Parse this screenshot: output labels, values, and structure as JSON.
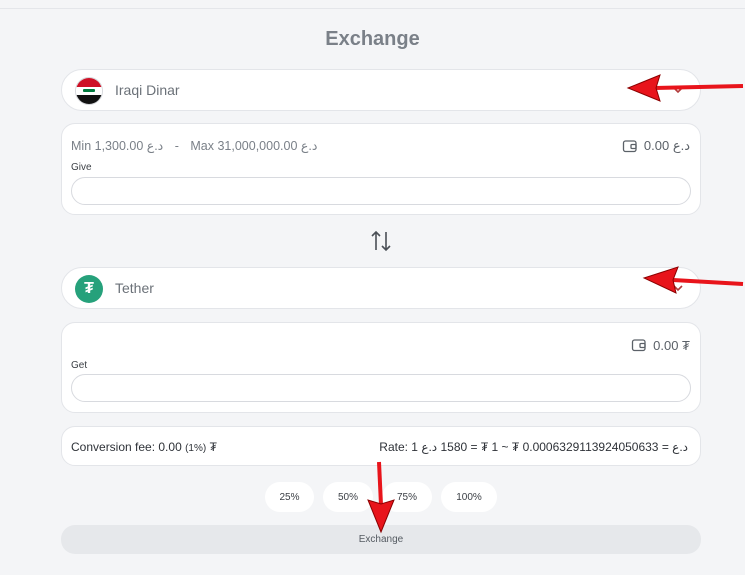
{
  "title": "Exchange",
  "from": {
    "currency_name": "Iraqi Dinar",
    "min_label": "Min 1,300.00 د.ع",
    "separator": "-",
    "max_label": "Max 31,000,000.00 د.ع",
    "balance": "0.00 د.ع",
    "field_label": "Give",
    "value": ""
  },
  "to": {
    "currency_name": "Tether",
    "balance": "0.00 ₮",
    "field_label": "Get",
    "value": ""
  },
  "fee": {
    "label": "Conversion fee: 0.00",
    "percent": "(1%)",
    "unit": "₮",
    "rate": "Rate: 1 د.ع = 0.0006329113924050633 ₮ ~ 1 ₮ = 1580 د.ع"
  },
  "percent_buttons": [
    "25%",
    "50%",
    "75%",
    "100%"
  ],
  "exchange_button": "Exchange",
  "icons": {
    "from_flag": "iraq-flag-icon",
    "to_logo": "tether-icon",
    "swap": "swap-arrows-icon",
    "wallet": "wallet-icon",
    "chevron": "chevron-down-icon"
  },
  "colors": {
    "accent_tether": "#26a17b",
    "annotation_arrow": "#e8141b"
  }
}
